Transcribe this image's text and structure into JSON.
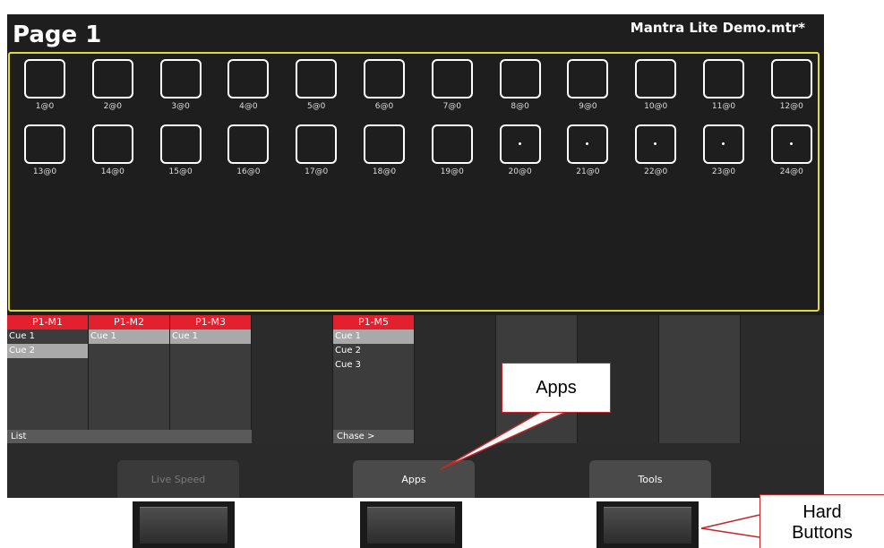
{
  "header": {
    "page_title": "Page 1",
    "file_name": "Mantra Lite Demo.mtr*"
  },
  "fixtures": [
    {
      "label": "1@0",
      "dot": false
    },
    {
      "label": "2@0",
      "dot": false
    },
    {
      "label": "3@0",
      "dot": false
    },
    {
      "label": "4@0",
      "dot": false
    },
    {
      "label": "5@0",
      "dot": false
    },
    {
      "label": "6@0",
      "dot": false
    },
    {
      "label": "7@0",
      "dot": false
    },
    {
      "label": "8@0",
      "dot": false
    },
    {
      "label": "9@0",
      "dot": false
    },
    {
      "label": "10@0",
      "dot": false
    },
    {
      "label": "11@0",
      "dot": false
    },
    {
      "label": "12@0",
      "dot": false
    },
    {
      "label": "13@0",
      "dot": false
    },
    {
      "label": "14@0",
      "dot": false
    },
    {
      "label": "15@0",
      "dot": false
    },
    {
      "label": "16@0",
      "dot": false
    },
    {
      "label": "17@0",
      "dot": false
    },
    {
      "label": "18@0",
      "dot": false
    },
    {
      "label": "19@0",
      "dot": false
    },
    {
      "label": "20@0",
      "dot": true
    },
    {
      "label": "21@0",
      "dot": true
    },
    {
      "label": "22@0",
      "dot": true
    },
    {
      "label": "23@0",
      "dot": true
    },
    {
      "label": "24@0",
      "dot": true
    }
  ],
  "masters": {
    "m1": {
      "header": "P1-M1",
      "cues": [
        "Cue 1",
        "Cue 2"
      ],
      "selected": 1
    },
    "m2": {
      "header": "P1-M2",
      "cues": [
        "Cue 1"
      ],
      "selected": 0
    },
    "m3": {
      "header": "P1-M3",
      "cues": [
        "Cue 1"
      ],
      "selected": 0
    },
    "m5": {
      "header": "P1-M5",
      "cues": [
        "Cue 1",
        "Cue 2",
        "Cue 3"
      ],
      "selected": 0
    },
    "list_footer": "List",
    "chase_footer": "Chase >"
  },
  "softkeys": {
    "live_speed": "Live Speed",
    "apps": "Apps",
    "tools": "Tools"
  },
  "callouts": {
    "apps": "Apps",
    "hard_buttons_line1": "Hard",
    "hard_buttons_line2": "Buttons"
  },
  "colors": {
    "accent_red": "#e3202e",
    "fixture_border": "#e0d93a",
    "callout_border": "#c3272b"
  }
}
